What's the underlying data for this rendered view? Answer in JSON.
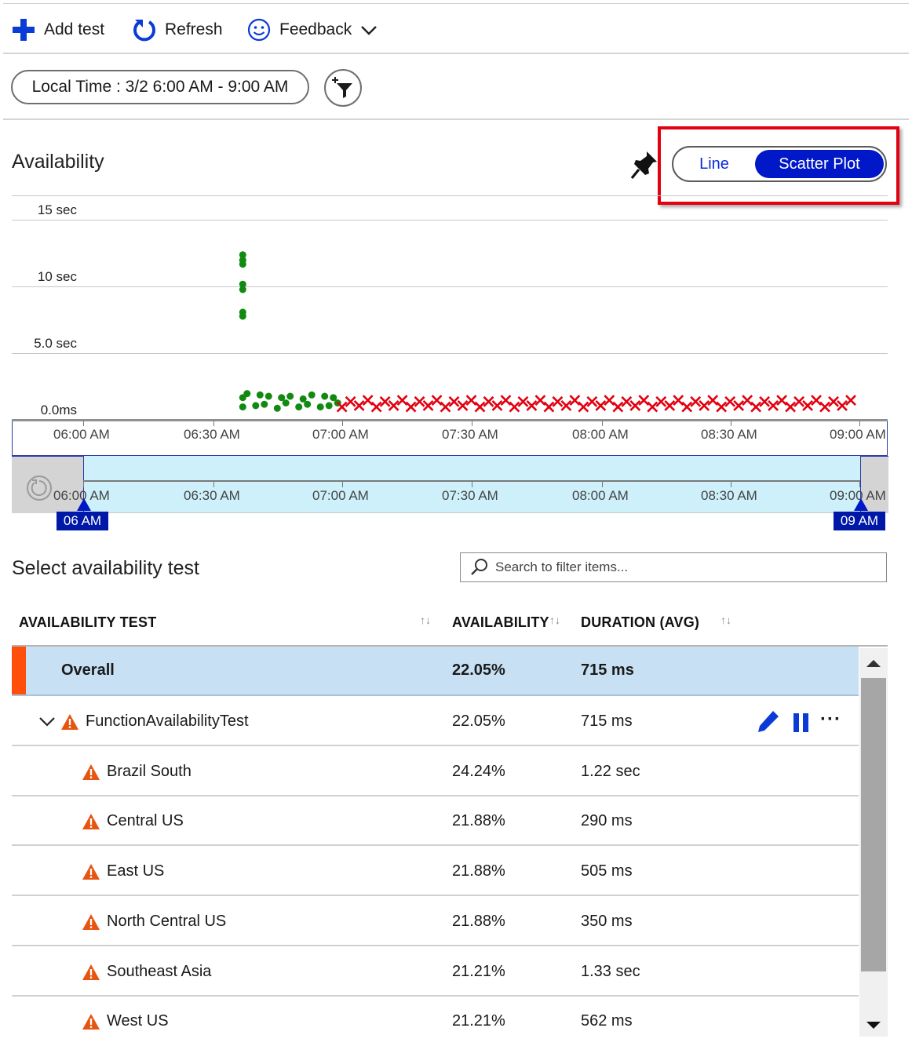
{
  "toolbar": {
    "add_test": "Add test",
    "refresh": "Refresh",
    "feedback": "Feedback"
  },
  "time_filter": {
    "label": "Local Time : 3/2 6:00 AM - 9:00 AM"
  },
  "availability": {
    "title": "Availability",
    "toggle_line": "Line",
    "toggle_scatter": "Scatter Plot",
    "toggle_selected": "Scatter Plot"
  },
  "chart_data": {
    "type": "scatter",
    "y_tick_labels": [
      "15 sec",
      "10 sec",
      "5.0 sec",
      "0.0ms"
    ],
    "x_tick_labels": [
      "06:00 AM",
      "06:30 AM",
      "07:00 AM",
      "07:30 AM",
      "08:00 AM",
      "08:30 AM",
      "09:00 AM"
    ],
    "ylim_sec": [
      0,
      15
    ],
    "x_range": [
      "06:00 AM",
      "09:00 AM"
    ],
    "grid": true,
    "series": [
      {
        "color": "#128a12",
        "marker": "dot",
        "points": [
          {
            "x": "06:37",
            "y": 11.6
          },
          {
            "x": "06:37",
            "y": 11.2
          },
          {
            "x": "06:37",
            "y": 10.9
          },
          {
            "x": "06:37",
            "y": 9.4
          },
          {
            "x": "06:37",
            "y": 9.0
          },
          {
            "x": "06:37",
            "y": 7.3
          },
          {
            "x": "06:37",
            "y": 7.0
          },
          {
            "x": "06:37",
            "y": 0.9
          },
          {
            "x": "06:37",
            "y": 0.2
          },
          {
            "x": "06:38",
            "y": 1.2
          },
          {
            "x": "06:40",
            "y": 0.3
          },
          {
            "x": "06:41",
            "y": 1.1
          },
          {
            "x": "06:42",
            "y": 0.4
          },
          {
            "x": "06:43",
            "y": 1.0
          },
          {
            "x": "06:45",
            "y": 0.1
          },
          {
            "x": "06:46",
            "y": 0.9
          },
          {
            "x": "06:47",
            "y": 0.5
          },
          {
            "x": "06:48",
            "y": 1.0
          },
          {
            "x": "06:50",
            "y": 0.2
          },
          {
            "x": "06:51",
            "y": 0.8
          },
          {
            "x": "06:52",
            "y": 0.4
          },
          {
            "x": "06:53",
            "y": 1.1
          },
          {
            "x": "06:55",
            "y": 0.2
          },
          {
            "x": "06:56",
            "y": 1.0
          },
          {
            "x": "06:57",
            "y": 0.3
          },
          {
            "x": "06:58",
            "y": 0.9
          },
          {
            "x": "06:59",
            "y": 0.5
          }
        ]
      },
      {
        "color": "#e3000f",
        "marker": "x",
        "x_start": "07:00",
        "x_end": "08:59",
        "step_minutes": 2,
        "y_values": [
          0.2,
          0.6,
          0.3,
          0.7
        ]
      }
    ]
  },
  "brush": {
    "x_tick_labels": [
      "06:00 AM",
      "06:30 AM",
      "07:00 AM",
      "07:30 AM",
      "08:00 AM",
      "08:30 AM",
      "09:00 AM"
    ],
    "start_badge": "06 AM",
    "end_badge": "09 AM"
  },
  "test_list": {
    "title": "Select availability test",
    "search_placeholder": "Search to filter items...",
    "columns": {
      "test": "AVAILABILITY TEST",
      "availability": "AVAILABILITY",
      "duration": "DURATION (AVG)"
    },
    "rows": [
      {
        "name": "Overall",
        "availability": "22.05%",
        "duration": "715 ms"
      },
      {
        "name": "FunctionAvailabilityTest",
        "availability": "22.05%",
        "duration": "715 ms"
      },
      {
        "name": "Brazil South",
        "availability": "24.24%",
        "duration": "1.22 sec"
      },
      {
        "name": "Central US",
        "availability": "21.88%",
        "duration": "290 ms"
      },
      {
        "name": "East US",
        "availability": "21.88%",
        "duration": "505 ms"
      },
      {
        "name": "North Central US",
        "availability": "21.88%",
        "duration": "350 ms"
      },
      {
        "name": "Southeast Asia",
        "availability": "21.21%",
        "duration": "1.33 sec"
      },
      {
        "name": "West US",
        "availability": "21.21%",
        "duration": "562 ms"
      }
    ]
  },
  "colors": {
    "accent_blue": "#0018c8",
    "overall_highlight": "#c7e0f4",
    "overall_marker": "#ff4f0a",
    "warning": "#e8540f",
    "success_green": "#128a12",
    "failure_red": "#e3000f"
  }
}
